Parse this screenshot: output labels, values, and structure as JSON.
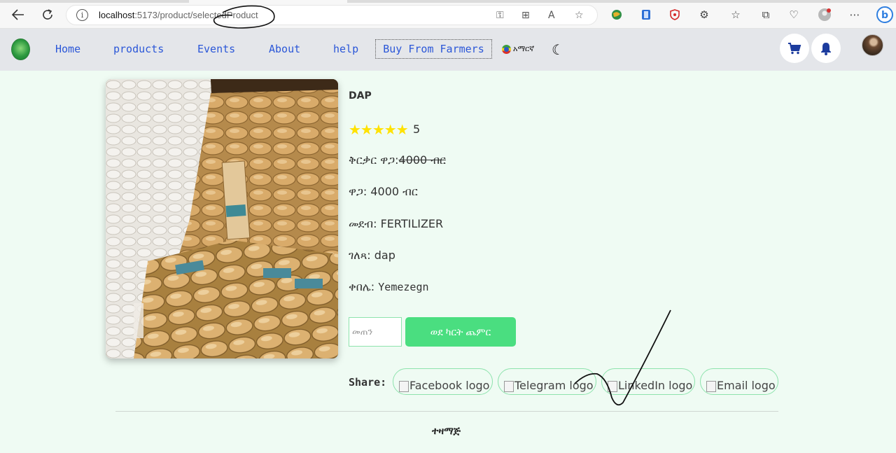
{
  "browser": {
    "url_host": "localhost",
    "url_rest": ":5173/product/selectedProduct",
    "icons": [
      "back-arrow-icon",
      "refresh-icon",
      "info-icon",
      "key-icon",
      "grid-icon",
      "read-aloud-icon",
      "star-icon",
      "extension-icons",
      "favorites-icon",
      "collections-icon",
      "health-icon",
      "profile-icon",
      "more-icon",
      "bing-icon"
    ]
  },
  "header": {
    "nav": [
      {
        "label": "Home"
      },
      {
        "label": "products"
      },
      {
        "label": "Events"
      },
      {
        "label": "About"
      },
      {
        "label": "help"
      }
    ],
    "buy_label": "Buy From Farmers",
    "language": "አማርኛ",
    "icons": [
      "logo",
      "moon-icon",
      "cart-icon",
      "bell-icon",
      "avatar"
    ]
  },
  "product": {
    "title": "DAP",
    "stars": "★★★★★",
    "rating": "5",
    "rating_value": 5,
    "old_price_label": "ቅርቃር ዋጋ:",
    "old_price_value": "4000 ብር",
    "price": "ዋጋ: 4000 ብር",
    "category": "መደብ: FERTILIZER",
    "description": "ገለጻ: dap",
    "seller_label": "ቀበሌ: ",
    "seller_value": "Yemezegn",
    "quantity_placeholder": "መጠን",
    "add_to_cart": "ወደ ካርት ጨምር"
  },
  "share": {
    "label": "Share:",
    "buttons": [
      {
        "alt": "Facebook logo"
      },
      {
        "alt": "Telegram logo"
      },
      {
        "alt": "LinkedIn logo"
      },
      {
        "alt": "Email logo"
      }
    ]
  },
  "footer": {
    "text": "ተዛማጅ"
  },
  "colors": {
    "page_bg": "#effbf3",
    "header_bg": "#e4e6ea",
    "link": "#2b57d8",
    "accent_green": "#4ade80",
    "star": "#ffe200"
  }
}
